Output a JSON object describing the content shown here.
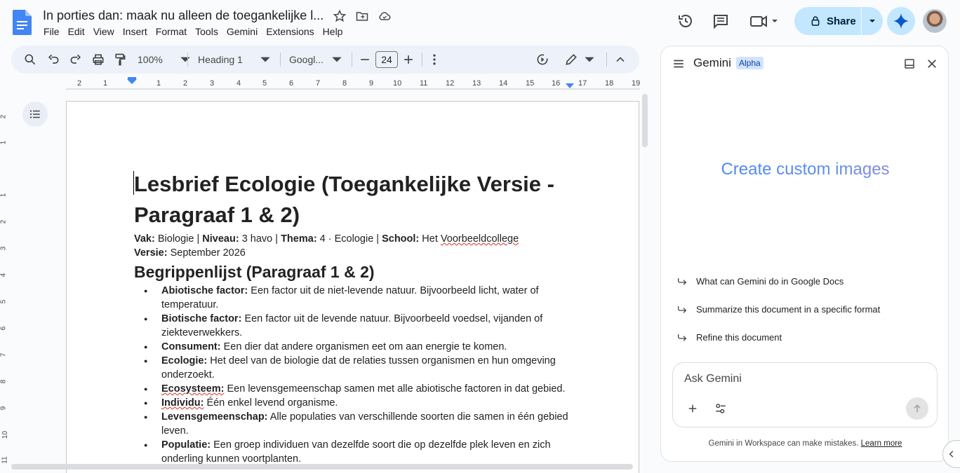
{
  "app": {
    "doc_title": "In porties dan: maak nu alleen de toegankelijke l...",
    "menu": [
      "File",
      "Edit",
      "View",
      "Insert",
      "Format",
      "Tools",
      "Gemini",
      "Extensions",
      "Help"
    ],
    "share_label": "Share"
  },
  "toolbar": {
    "zoom": "100%",
    "style": "Heading 1",
    "font": "Googl...",
    "font_size": "24"
  },
  "ruler": {
    "h_ticks": [
      "2",
      "1",
      "1",
      "2",
      "3",
      "4",
      "5",
      "6",
      "7",
      "8",
      "9",
      "10",
      "11",
      "12",
      "13",
      "14",
      "15",
      "16",
      "17",
      "18",
      "19"
    ],
    "v_ticks": [
      "2",
      "1",
      "1",
      "2",
      "3",
      "4",
      "5",
      "6",
      "7",
      "8",
      "9",
      "10",
      "11"
    ]
  },
  "document": {
    "title": "Lesbrief Ecologie (Toegankelijke Versie - Paragraaf 1 & 2)",
    "meta": {
      "vak_label": "Vak:",
      "vak": " Biologie | ",
      "niveau_label": "Niveau:",
      "niveau": " 3 havo | ",
      "thema_label": "Thema:",
      "thema": " 4 · Ecologie | ",
      "school_label": "School:",
      "school_pre": " Het ",
      "school_name": "Voorbeeldcollege",
      "versie_label": "Versie:",
      "versie": " September 2026"
    },
    "section_heading": "Begrippenlijst (Paragraaf 1 & 2)",
    "terms": [
      {
        "term": "Abiotische factor:",
        "def": " Een factor uit de niet-levende natuur. Bijvoorbeeld licht, water of temperatuur."
      },
      {
        "term": "Biotische factor:",
        "def": " Een factor uit de levende natuur. Bijvoorbeeld voedsel, vijanden of ziekteverwekkers."
      },
      {
        "term": "Consument:",
        "def": " Een dier dat andere organismen eet om aan energie te komen."
      },
      {
        "term": "Ecologie:",
        "def": " Het deel van de biologie dat de relaties tussen organismen en hun omgeving onderzoekt."
      },
      {
        "term": "Ecosysteem:",
        "def": " Een levensgemeenschap samen met alle abiotische factoren in dat gebied."
      },
      {
        "term": "Individu:",
        "def": " Één enkel levend organisme."
      },
      {
        "term": "Levensgemeenschap:",
        "def": " Alle populaties van verschillende soorten die samen in één gebied leven."
      },
      {
        "term": "Populatie:",
        "def": " Een groep individuen van dezelfde soort die op dezelfde plek leven en zich onderling kunnen voortplanten."
      }
    ]
  },
  "gemini": {
    "title": "Gemini",
    "badge": "Alpha",
    "hero": "Create custom images",
    "suggestions": [
      "What can Gemini do in Google Docs",
      "Summarize this document in a specific format",
      "Refine this document"
    ],
    "input_placeholder": "Ask Gemini",
    "footer_text": "Gemini in Workspace can make mistakes. ",
    "footer_link": "Learn more"
  }
}
